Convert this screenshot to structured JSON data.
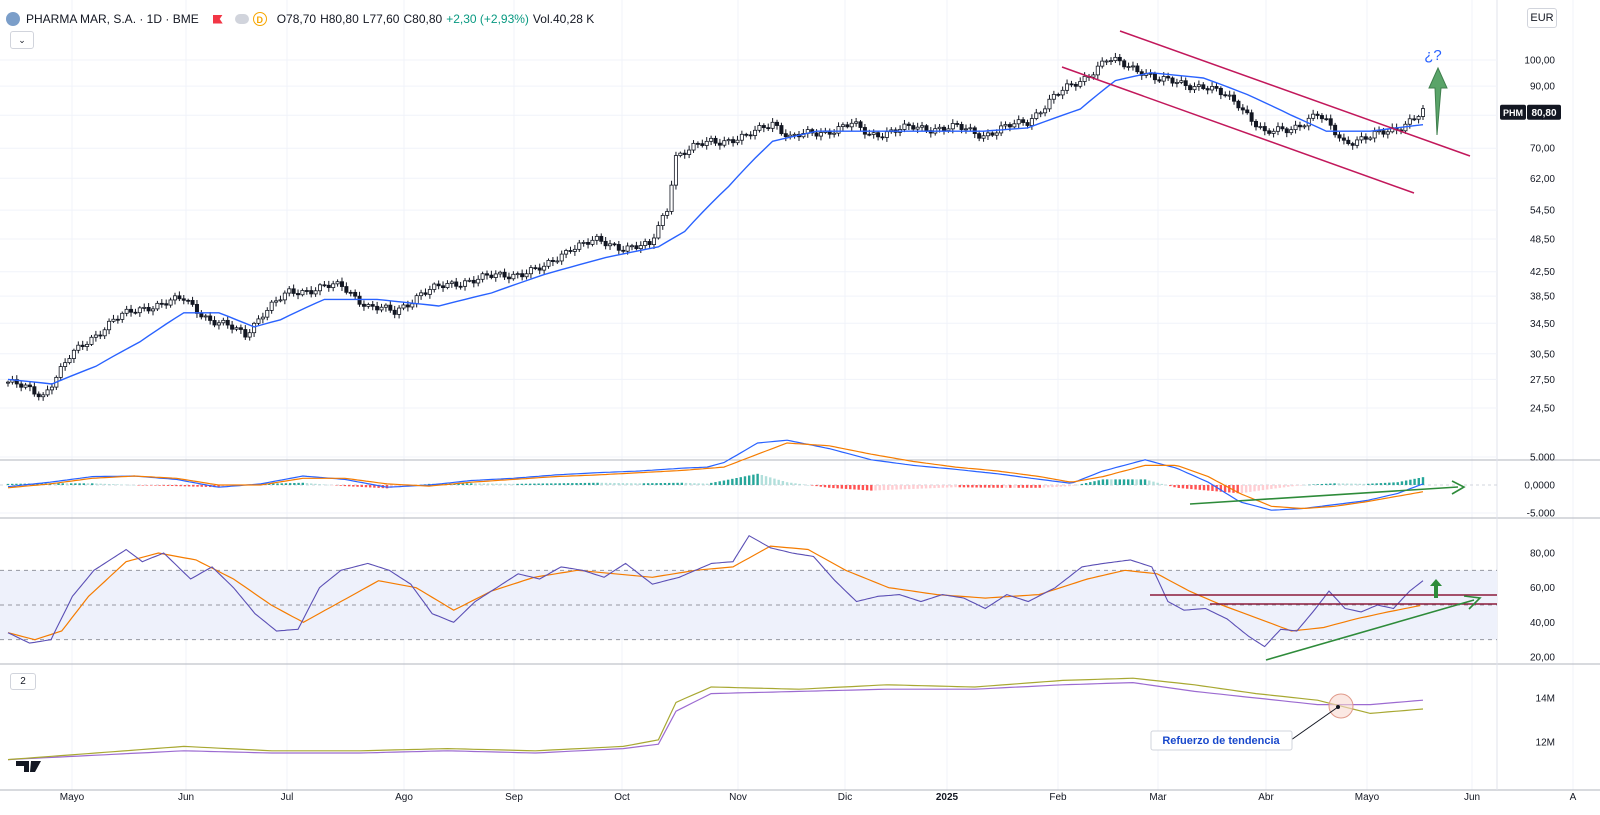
{
  "header": {
    "symbol": "PHARMA MAR, S.A. · 1D · BME",
    "badge": "D",
    "open": "O78,70",
    "high": "H80,80",
    "low": "L77,60",
    "close": "C80,80",
    "change": "+2,30 (+2,93%)",
    "volume": "Vol.40,28 K"
  },
  "currency": "EUR",
  "pane4_tag": "2",
  "colors": {
    "up": "#089981",
    "down": "#131722",
    "sma": "#2962ff",
    "orange": "#f57c00",
    "channel": "#c2185b",
    "green": "#2e8b3a",
    "rsi": "#5b4fb5",
    "vol1": "#9c6bd1",
    "vol2": "#a8a832"
  },
  "chart_data": [
    {
      "type": "candlestick",
      "pane": "price",
      "ticker_label": "PHM",
      "last_price_label": "80,80",
      "y_scale": "log",
      "y_ticks": [
        "100,00",
        "90,00",
        "80,00",
        "70,00",
        "62,00",
        "54,50",
        "48,50",
        "42,50",
        "38,50",
        "34,50",
        "30,50",
        "27,50",
        "24,50"
      ],
      "x_ticks": [
        "Mayo",
        "Jun",
        "Jul",
        "Ago",
        "Sep",
        "Oct",
        "Nov",
        "Dic",
        "2025",
        "Feb",
        "Mar",
        "Abr",
        "Mayo",
        "Jun",
        "A"
      ],
      "anchors": [
        [
          0,
          27.2
        ],
        [
          8,
          25.8
        ],
        [
          14,
          30
        ],
        [
          24,
          35
        ],
        [
          32,
          37
        ],
        [
          40,
          38
        ],
        [
          46,
          35
        ],
        [
          54,
          33
        ],
        [
          58,
          36
        ],
        [
          64,
          39
        ],
        [
          72,
          40
        ],
        [
          76,
          40
        ],
        [
          82,
          37
        ],
        [
          88,
          36
        ],
        [
          94,
          39
        ],
        [
          104,
          41
        ],
        [
          114,
          42
        ],
        [
          122,
          43
        ],
        [
          128,
          47
        ],
        [
          134,
          48
        ],
        [
          140,
          47
        ],
        [
          146,
          47
        ],
        [
          150,
          55
        ],
        [
          152,
          68
        ],
        [
          160,
          72
        ],
        [
          168,
          73
        ],
        [
          174,
          78
        ],
        [
          178,
          73
        ],
        [
          186,
          75
        ],
        [
          192,
          77
        ],
        [
          196,
          74
        ],
        [
          206,
          76
        ],
        [
          216,
          76
        ],
        [
          222,
          74
        ],
        [
          232,
          78
        ],
        [
          238,
          86
        ],
        [
          244,
          92
        ],
        [
          250,
          100
        ],
        [
          258,
          96
        ],
        [
          262,
          92
        ],
        [
          272,
          90
        ],
        [
          280,
          84
        ],
        [
          286,
          74
        ],
        [
          292,
          76
        ],
        [
          298,
          80
        ],
        [
          304,
          72
        ],
        [
          310,
          73
        ],
        [
          316,
          76
        ],
        [
          322,
          80.8
        ]
      ],
      "sma": [
        [
          0,
          27.5
        ],
        [
          10,
          27
        ],
        [
          20,
          29
        ],
        [
          30,
          32
        ],
        [
          40,
          36
        ],
        [
          48,
          36
        ],
        [
          56,
          34
        ],
        [
          62,
          35
        ],
        [
          72,
          38
        ],
        [
          84,
          38
        ],
        [
          98,
          37
        ],
        [
          110,
          39
        ],
        [
          122,
          42
        ],
        [
          136,
          45
        ],
        [
          148,
          47
        ],
        [
          154,
          50
        ],
        [
          164,
          60
        ],
        [
          174,
          72
        ],
        [
          184,
          75
        ],
        [
          196,
          75
        ],
        [
          210,
          75
        ],
        [
          222,
          75
        ],
        [
          232,
          76
        ],
        [
          244,
          82
        ],
        [
          252,
          92
        ],
        [
          260,
          95
        ],
        [
          272,
          93
        ],
        [
          282,
          87
        ],
        [
          292,
          80
        ],
        [
          300,
          75
        ],
        [
          310,
          75
        ],
        [
          322,
          77
        ]
      ],
      "channel_upper": [
        [
          1120,
          31
        ],
        [
          1470,
          156
        ]
      ],
      "channel_lower": [
        [
          1062,
          67
        ],
        [
          1414,
          193
        ]
      ],
      "annotation": "¿?"
    },
    {
      "type": "macd",
      "pane": "macd",
      "y_ticks": [
        "5.000",
        "0,0000",
        "-5.000"
      ],
      "macd": [
        [
          0,
          -0.3
        ],
        [
          20,
          0.5
        ],
        [
          40,
          1.5
        ],
        [
          60,
          1.6
        ],
        [
          80,
          1.0
        ],
        [
          100,
          -0.4
        ],
        [
          120,
          0.2
        ],
        [
          140,
          1.6
        ],
        [
          160,
          1.0
        ],
        [
          180,
          -0.4
        ],
        [
          200,
          0
        ],
        [
          220,
          0.8
        ],
        [
          240,
          1.2
        ],
        [
          260,
          1.8
        ],
        [
          280,
          2.2
        ],
        [
          300,
          2.5
        ],
        [
          320,
          3.0
        ],
        [
          332,
          3.2
        ],
        [
          340,
          4.0
        ],
        [
          356,
          7.5
        ],
        [
          370,
          8.0
        ],
        [
          390,
          6.5
        ],
        [
          410,
          4.5
        ],
        [
          430,
          3.5
        ],
        [
          450,
          2.8
        ],
        [
          470,
          2.0
        ],
        [
          490,
          1.0
        ],
        [
          505,
          0.3
        ],
        [
          520,
          2.5
        ],
        [
          540,
          4.5
        ],
        [
          555,
          3.0
        ],
        [
          570,
          0.5
        ],
        [
          585,
          -3.0
        ],
        [
          600,
          -4.5
        ],
        [
          615,
          -4.2
        ],
        [
          630,
          -3.5
        ],
        [
          645,
          -2.8
        ],
        [
          660,
          -1.5
        ],
        [
          672,
          0.2
        ]
      ],
      "signal": [
        [
          0,
          -0.5
        ],
        [
          20,
          0.2
        ],
        [
          40,
          1.2
        ],
        [
          60,
          1.6
        ],
        [
          80,
          1.2
        ],
        [
          100,
          0
        ],
        [
          120,
          0
        ],
        [
          140,
          1.2
        ],
        [
          160,
          1.2
        ],
        [
          180,
          0.2
        ],
        [
          200,
          -0.2
        ],
        [
          220,
          0.5
        ],
        [
          240,
          1.0
        ],
        [
          260,
          1.5
        ],
        [
          280,
          1.8
        ],
        [
          300,
          2.2
        ],
        [
          320,
          2.6
        ],
        [
          340,
          3.2
        ],
        [
          356,
          5.5
        ],
        [
          370,
          7.5
        ],
        [
          390,
          7.0
        ],
        [
          410,
          5.5
        ],
        [
          430,
          4.2
        ],
        [
          450,
          3.2
        ],
        [
          470,
          2.5
        ],
        [
          490,
          1.5
        ],
        [
          505,
          0.5
        ],
        [
          520,
          1.5
        ],
        [
          540,
          3.5
        ],
        [
          555,
          3.5
        ],
        [
          570,
          1.5
        ],
        [
          585,
          -1.5
        ],
        [
          600,
          -3.8
        ],
        [
          615,
          -4.2
        ],
        [
          630,
          -3.8
        ],
        [
          645,
          -3.0
        ],
        [
          660,
          -2.0
        ],
        [
          672,
          -1.2
        ]
      ]
    },
    {
      "type": "rsi",
      "pane": "rsi",
      "y_ticks": [
        "80,00",
        "60,00",
        "40,00",
        "20,00"
      ],
      "bands": [
        70,
        50,
        30
      ],
      "rsi": [
        [
          0,
          34
        ],
        [
          8,
          28
        ],
        [
          16,
          30
        ],
        [
          24,
          55
        ],
        [
          32,
          70
        ],
        [
          44,
          82
        ],
        [
          50,
          75
        ],
        [
          58,
          80
        ],
        [
          68,
          65
        ],
        [
          76,
          72
        ],
        [
          84,
          60
        ],
        [
          92,
          45
        ],
        [
          100,
          35
        ],
        [
          108,
          36
        ],
        [
          116,
          60
        ],
        [
          124,
          70
        ],
        [
          134,
          74
        ],
        [
          142,
          70
        ],
        [
          150,
          62
        ],
        [
          158,
          45
        ],
        [
          166,
          40
        ],
        [
          174,
          52
        ],
        [
          182,
          60
        ],
        [
          190,
          68
        ],
        [
          198,
          65
        ],
        [
          206,
          72
        ],
        [
          214,
          70
        ],
        [
          222,
          66
        ],
        [
          230,
          74
        ],
        [
          240,
          62
        ],
        [
          250,
          66
        ],
        [
          262,
          74
        ],
        [
          270,
          75
        ],
        [
          276,
          90
        ],
        [
          284,
          83
        ],
        [
          292,
          80
        ],
        [
          300,
          78
        ],
        [
          308,
          64
        ],
        [
          316,
          52
        ],
        [
          324,
          55
        ],
        [
          332,
          56
        ],
        [
          340,
          52
        ],
        [
          348,
          56
        ],
        [
          356,
          54
        ],
        [
          364,
          48
        ],
        [
          372,
          56
        ],
        [
          380,
          52
        ],
        [
          390,
          60
        ],
        [
          400,
          72
        ],
        [
          408,
          74
        ],
        [
          418,
          76
        ],
        [
          426,
          72
        ],
        [
          432,
          52
        ],
        [
          438,
          47
        ],
        [
          446,
          48
        ],
        [
          454,
          42
        ],
        [
          462,
          32
        ],
        [
          468,
          26
        ],
        [
          474,
          36
        ],
        [
          480,
          35
        ],
        [
          486,
          46
        ],
        [
          492,
          58
        ],
        [
          498,
          48
        ],
        [
          504,
          46
        ],
        [
          510,
          50
        ],
        [
          516,
          48
        ],
        [
          522,
          58
        ],
        [
          527,
          64
        ]
      ],
      "rsi_ma": [
        [
          0,
          34
        ],
        [
          10,
          30
        ],
        [
          20,
          35
        ],
        [
          30,
          55
        ],
        [
          44,
          75
        ],
        [
          56,
          80
        ],
        [
          70,
          76
        ],
        [
          84,
          65
        ],
        [
          98,
          50
        ],
        [
          110,
          40
        ],
        [
          124,
          52
        ],
        [
          138,
          64
        ],
        [
          152,
          60
        ],
        [
          166,
          47
        ],
        [
          180,
          58
        ],
        [
          196,
          66
        ],
        [
          212,
          70
        ],
        [
          226,
          68
        ],
        [
          240,
          66
        ],
        [
          256,
          70
        ],
        [
          270,
          72
        ],
        [
          284,
          84
        ],
        [
          298,
          82
        ],
        [
          312,
          70
        ],
        [
          328,
          60
        ],
        [
          346,
          56
        ],
        [
          364,
          54
        ],
        [
          384,
          56
        ],
        [
          402,
          65
        ],
        [
          416,
          70
        ],
        [
          428,
          68
        ],
        [
          440,
          58
        ],
        [
          452,
          50
        ],
        [
          466,
          42
        ],
        [
          478,
          35
        ],
        [
          490,
          37
        ],
        [
          502,
          42
        ],
        [
          514,
          46
        ],
        [
          527,
          50
        ]
      ],
      "rsi_ma_note": "index scale aligned to price bars"
    },
    {
      "type": "line",
      "pane": "volume-ma",
      "y_ticks": [
        "14M",
        "12M"
      ],
      "series": [
        {
          "points": [
            [
              0,
              11.2
            ],
            [
              20,
              11.4
            ],
            [
              40,
              11.6
            ],
            [
              60,
              11.5
            ],
            [
              80,
              11.5
            ],
            [
              100,
              11.6
            ],
            [
              120,
              11.5
            ],
            [
              140,
              11.7
            ],
            [
              148,
              11.9
            ],
            [
              152,
              13.4
            ],
            [
              160,
              14.2
            ],
            [
              180,
              14.3
            ],
            [
              200,
              14.4
            ],
            [
              220,
              14.4
            ],
            [
              240,
              14.6
            ],
            [
              256,
              14.7
            ],
            [
              270,
              14.3
            ],
            [
              284,
              14.0
            ],
            [
              298,
              13.7
            ],
            [
              310,
              13.7
            ],
            [
              322,
              13.9
            ]
          ]
        },
        {
          "points": [
            [
              0,
              11.2
            ],
            [
              20,
              11.5
            ],
            [
              40,
              11.8
            ],
            [
              60,
              11.6
            ],
            [
              80,
              11.6
            ],
            [
              100,
              11.7
            ],
            [
              120,
              11.6
            ],
            [
              140,
              11.8
            ],
            [
              148,
              12.1
            ],
            [
              152,
              13.8
            ],
            [
              160,
              14.5
            ],
            [
              180,
              14.4
            ],
            [
              200,
              14.6
            ],
            [
              220,
              14.5
            ],
            [
              240,
              14.8
            ],
            [
              256,
              14.9
            ],
            [
              270,
              14.6
            ],
            [
              284,
              14.2
            ],
            [
              298,
              13.9
            ],
            [
              310,
              13.3
            ],
            [
              322,
              13.5
            ]
          ]
        }
      ],
      "annotation": "Refuerzo de tendencia"
    }
  ]
}
